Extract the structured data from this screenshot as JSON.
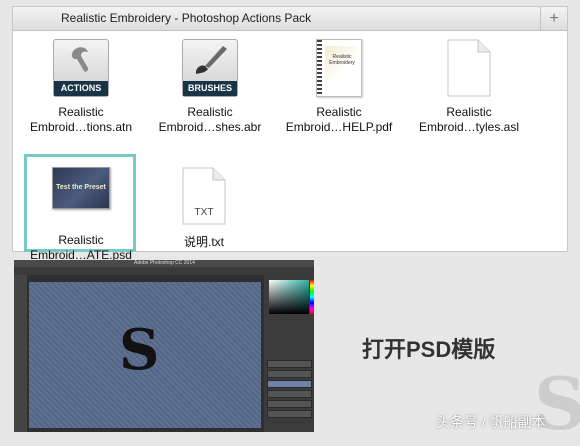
{
  "window": {
    "title": "Realistic Embroidery - Photoshop Actions Pack",
    "add_label": "+"
  },
  "files": [
    {
      "line1": "Realistic",
      "line2": "Embroid…tions.atn",
      "badge": "ACTIONS",
      "icon": "actions-icon"
    },
    {
      "line1": "Realistic",
      "line2": "Embroid…shes.abr",
      "badge": "BRUSHES",
      "icon": "brushes-icon"
    },
    {
      "line1": "Realistic",
      "line2": "Embroid…HELP.pdf",
      "thumb_text": "Realistic Embroidery",
      "icon": "pdf-document-icon"
    },
    {
      "line1": "Realistic",
      "line2": "Embroid…tyles.asl",
      "icon": "blank-document-icon"
    },
    {
      "line1": "Realistic",
      "line2": "Embroid…ATE.psd",
      "thumb_text": "Test the Preset",
      "icon": "psd-thumbnail-icon",
      "selected": true
    },
    {
      "line1": "说明.txt",
      "badge": "TXT",
      "icon": "txt-document-icon"
    }
  ],
  "photoshop": {
    "app_title": "Adobe Photoshop CC 2014",
    "logo_text": "S",
    "accent": "#2fb2a8"
  },
  "caption": "打开PSD模版",
  "watermark": "头条号 / 帆船副本",
  "colors": {
    "selection": "#78c8c4",
    "actions_badge": "#1a3447"
  }
}
